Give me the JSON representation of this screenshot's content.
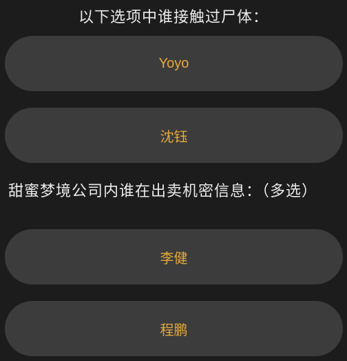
{
  "question_1": {
    "text": "以下选项中谁接触过尸体：",
    "options": [
      {
        "label": "Yoyo"
      },
      {
        "label": "沈钰"
      }
    ]
  },
  "question_2": {
    "text": "甜蜜梦境公司内谁在出卖机密信息：（多选）",
    "options": [
      {
        "label": "李健"
      },
      {
        "label": "程鹏"
      }
    ]
  },
  "colors": {
    "background": "#1c1c1c",
    "option_background": "#3c3c3c",
    "question_text": "#eaeaea",
    "option_text": "#e6a93a"
  }
}
